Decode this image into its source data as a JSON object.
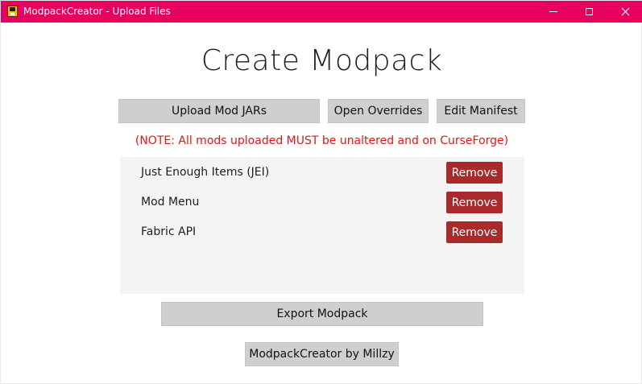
{
  "window": {
    "title": "ModpackCreator - Upload Files",
    "titlebar_color": "#e8005f",
    "controls": [
      "minimize-icon",
      "maximize-icon",
      "close-icon"
    ]
  },
  "page": {
    "heading": "Create Modpack",
    "note": "(NOTE: All mods uploaded MUST be unaltered and on CurseForge)",
    "note_color": "#e31515"
  },
  "toolbar": {
    "upload_label": "Upload Mod JARs",
    "overrides_label": "Open Overrides",
    "manifest_label": "Edit Manifest"
  },
  "mods": [
    {
      "name": "Just Enough Items (JEI)",
      "action": "Remove"
    },
    {
      "name": "Mod Menu",
      "action": "Remove"
    },
    {
      "name": "Fabric API",
      "action": "Remove"
    }
  ],
  "remove_button_color": "#a82a2a",
  "footer": {
    "export_label": "Export Modpack",
    "credit_label": "ModpackCreator by Millzy"
  }
}
